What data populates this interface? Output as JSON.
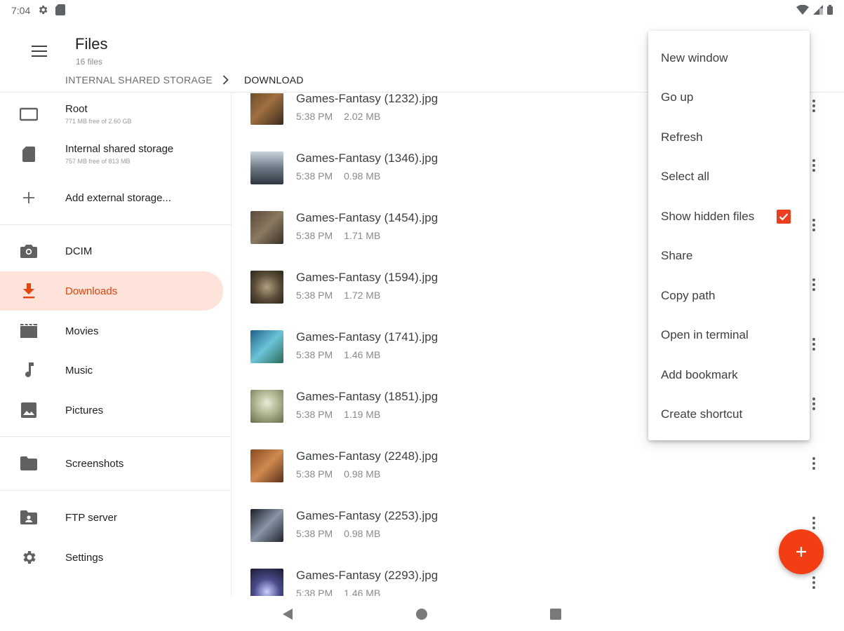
{
  "status_bar": {
    "time": "7:04",
    "icons": [
      "settings-icon",
      "sd-card-icon",
      "wifi-icon",
      "signal-icon",
      "battery-icon"
    ]
  },
  "app_bar": {
    "title": "Files",
    "subtitle": "16 files",
    "breadcrumb": [
      "INTERNAL SHARED STORAGE",
      "DOWNLOAD"
    ]
  },
  "sidebar": {
    "storage": [
      {
        "label": "Root",
        "sub": "771 MB free of 2.60 GB",
        "icon": "tablet-icon"
      },
      {
        "label": "Internal shared storage",
        "sub": "757 MB free of 813 MB",
        "icon": "sd-card-icon"
      },
      {
        "label": "Add external storage...",
        "icon": "plus-icon"
      }
    ],
    "folders": [
      {
        "label": "DCIM",
        "icon": "camera-icon"
      },
      {
        "label": "Downloads",
        "icon": "download-icon",
        "active": true
      },
      {
        "label": "Movies",
        "icon": "movie-icon"
      },
      {
        "label": "Music",
        "icon": "music-note-icon"
      },
      {
        "label": "Pictures",
        "icon": "image-icon"
      }
    ],
    "bookmarks": [
      {
        "label": "Screenshots",
        "icon": "folder-icon"
      }
    ],
    "other": [
      {
        "label": "FTP server",
        "icon": "ftp-folder-icon"
      },
      {
        "label": "Settings",
        "icon": "gear-icon"
      }
    ]
  },
  "files": [
    {
      "name": "Games-Fantasy (1232).jpg",
      "time": "5:38 PM",
      "size": "2.02 MB"
    },
    {
      "name": "Games-Fantasy (1346).jpg",
      "time": "5:38 PM",
      "size": "0.98 MB"
    },
    {
      "name": "Games-Fantasy (1454).jpg",
      "time": "5:38 PM",
      "size": "1.71 MB"
    },
    {
      "name": "Games-Fantasy (1594).jpg",
      "time": "5:38 PM",
      "size": "1.72 MB"
    },
    {
      "name": "Games-Fantasy (1741).jpg",
      "time": "5:38 PM",
      "size": "1.46 MB"
    },
    {
      "name": "Games-Fantasy (1851).jpg",
      "time": "5:38 PM",
      "size": "1.19 MB"
    },
    {
      "name": "Games-Fantasy (2248).jpg",
      "time": "5:38 PM",
      "size": "0.98 MB"
    },
    {
      "name": "Games-Fantasy (2253).jpg",
      "time": "5:38 PM",
      "size": "0.98 MB"
    },
    {
      "name": "Games-Fantasy (2293).jpg",
      "time": "5:38 PM",
      "size": "1.46 MB"
    }
  ],
  "overflow_menu": {
    "items": [
      "New window",
      "Go up",
      "Refresh",
      "Select all",
      "Show hidden files",
      "Share",
      "Copy path",
      "Open in terminal",
      "Add bookmark",
      "Create shortcut"
    ],
    "show_hidden_files_checked": true
  },
  "colors": {
    "accent": "#f23e12",
    "active_bg": "#fde3da",
    "active_text": "#e8430a"
  }
}
